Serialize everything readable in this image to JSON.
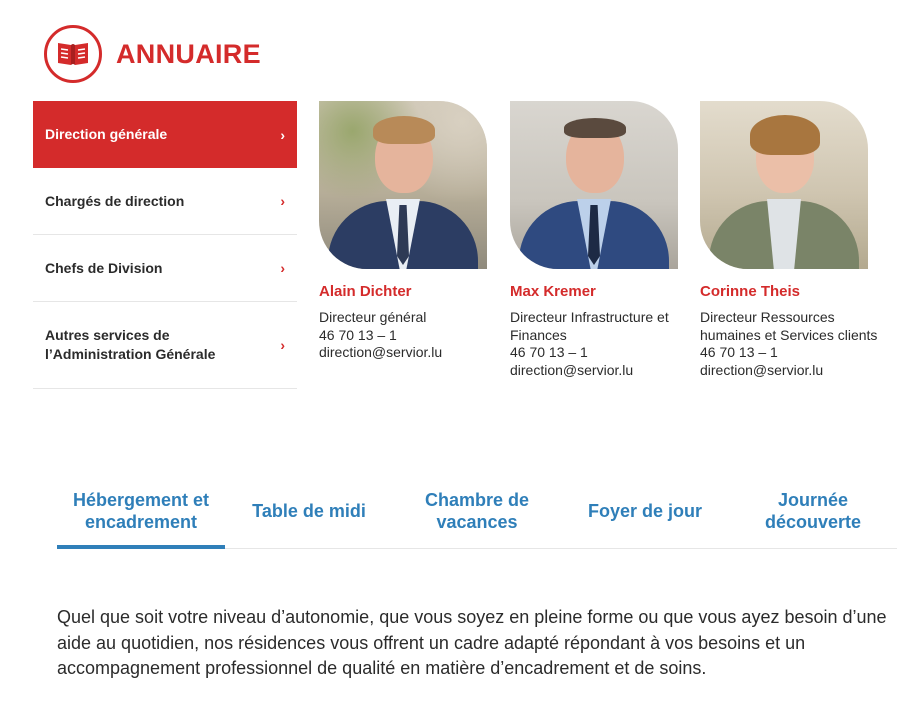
{
  "header": {
    "title": "ANNUAIRE",
    "icon": "book-icon"
  },
  "sidebar": {
    "items": [
      {
        "label": "Direction générale",
        "active": true
      },
      {
        "label": "Chargés de direction",
        "active": false
      },
      {
        "label": "Chefs de Division",
        "active": false
      },
      {
        "label": "Autres services de l’Administration Générale",
        "active": false
      }
    ],
    "chevron": "›"
  },
  "people": [
    {
      "name": "Alain Dichter",
      "role": "Directeur général",
      "phone": "46 70 13 – 1",
      "email": "direction@servior.lu"
    },
    {
      "name": "Max Kremer",
      "role": "Directeur Infrastructure et Finances",
      "phone": "46 70 13 – 1",
      "email": "direction@servior.lu"
    },
    {
      "name": "Corinne Theis",
      "role": "Directeur Ressources humaines et Services clients",
      "phone": "46 70 13 – 1",
      "email": "direction@servior.lu"
    }
  ],
  "tabs": [
    {
      "label": "Hébergement et encadrement",
      "active": true
    },
    {
      "label": "Table de midi",
      "active": false
    },
    {
      "label": "Chambre de vacances",
      "active": false
    },
    {
      "label": "Foyer de jour",
      "active": false
    },
    {
      "label": "Journée découverte",
      "active": false
    }
  ],
  "content": {
    "paragraph": "Quel que soit votre niveau d’autonomie, que vous soyez en pleine forme ou que vous ayez besoin d’une aide au quotidien, nos résidences vous offrent un cadre adapté répondant à vos besoins et un accompagnement professionnel de qualité en matière d’encadrement et de soins."
  },
  "colors": {
    "accent": "#d42b2b",
    "link": "#2f7fb9",
    "text": "#2b2b2b"
  }
}
